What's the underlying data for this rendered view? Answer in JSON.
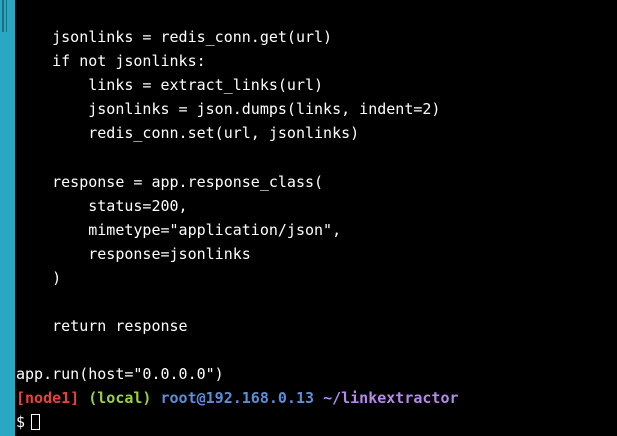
{
  "code_lines": [
    "    jsonlinks = redis_conn.get(url)",
    "    if not jsonlinks:",
    "        links = extract_links(url)",
    "        jsonlinks = json.dumps(links, indent=2)",
    "        redis_conn.set(url, jsonlinks)",
    "",
    "    response = app.response_class(",
    "        status=200,",
    "        mimetype=\"application/json\",",
    "        response=jsonlinks",
    "    )",
    "",
    "    return response",
    "",
    "app.run(host=\"0.0.0.0\")"
  ],
  "prompt": {
    "node": "[node1]",
    "env": "(local)",
    "user_host": "root@192.168.0.13",
    "path": "~/linkextractor",
    "symbol": "$"
  },
  "colors": {
    "side_bar": "#2aa7c2",
    "background": "#000000",
    "text": "#ffffff",
    "node": "#e8413c",
    "env": "#9bd23b",
    "user_host": "#5a8fd8",
    "path": "#b48ae8"
  }
}
